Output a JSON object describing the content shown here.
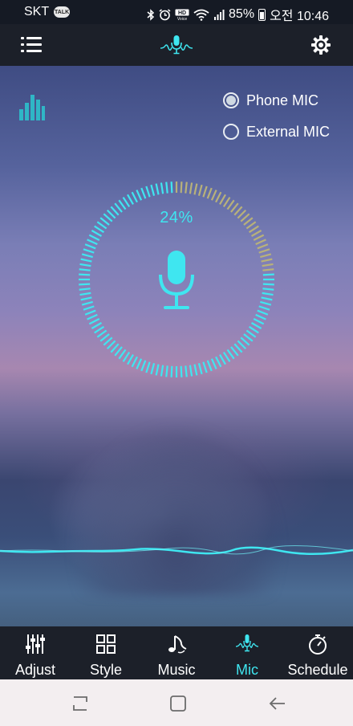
{
  "status_bar": {
    "carrier": "SKT",
    "talk_badge": "TALK",
    "battery": "85%",
    "time": "오전 10:46",
    "icons": [
      "bluetooth-icon",
      "alarm-icon",
      "hd-voice-icon",
      "wifi-icon",
      "signal-icon",
      "battery-icon"
    ]
  },
  "toolbar": {
    "menu_icon": "menu-icon",
    "logo_icon": "mic-wave-logo-icon",
    "settings_icon": "gear-icon"
  },
  "mic_source": {
    "options": [
      {
        "label": "Phone MIC",
        "selected": true
      },
      {
        "label": "External MIC",
        "selected": false
      }
    ]
  },
  "dial": {
    "percent_text": "24%",
    "percent": 24,
    "accent_color": "#3fe6f0",
    "inactive_color": "#b8b17a"
  },
  "tabs": [
    {
      "label": "Adjust",
      "icon": "sliders-icon",
      "active": false
    },
    {
      "label": "Style",
      "icon": "grid-icon",
      "active": false
    },
    {
      "label": "Music",
      "icon": "music-note-icon",
      "active": false
    },
    {
      "label": "Mic",
      "icon": "mic-icon",
      "active": true
    },
    {
      "label": "Schedule",
      "icon": "stopwatch-icon",
      "active": false
    }
  ],
  "nav": {
    "buttons": [
      "recent-apps-icon",
      "home-icon",
      "back-icon"
    ]
  }
}
